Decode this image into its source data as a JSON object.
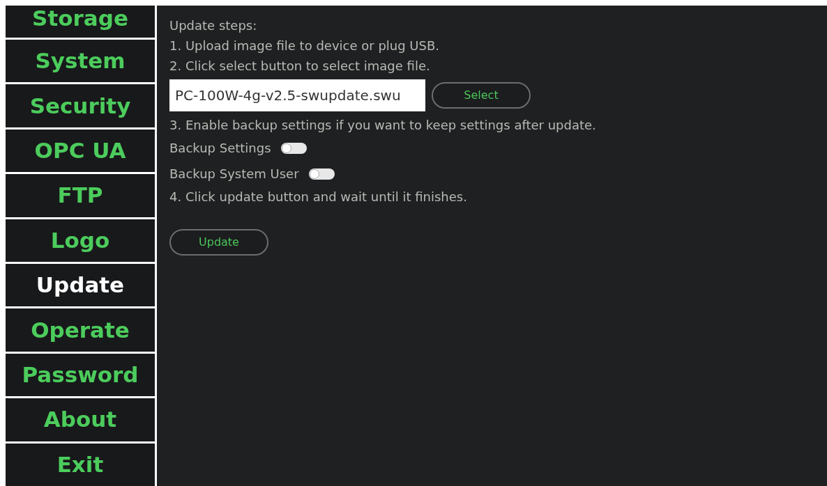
{
  "sidebar": {
    "items": [
      {
        "label": "Storage",
        "selected": false
      },
      {
        "label": "System",
        "selected": false
      },
      {
        "label": "Security",
        "selected": false
      },
      {
        "label": "OPC UA",
        "selected": false
      },
      {
        "label": "FTP",
        "selected": false
      },
      {
        "label": "Logo",
        "selected": false
      },
      {
        "label": "Update",
        "selected": true
      },
      {
        "label": "Operate",
        "selected": false
      },
      {
        "label": "Password",
        "selected": false
      },
      {
        "label": "About",
        "selected": false
      },
      {
        "label": "Exit",
        "selected": false
      }
    ]
  },
  "content": {
    "items": [
      {
        "kind": "text",
        "text": "Update steps:"
      },
      {
        "kind": "text",
        "text": "1. Upload image file to device or plug USB."
      },
      {
        "kind": "text",
        "text": "2. Click select button to select image file."
      },
      {
        "kind": "file",
        "value": "PC-100W-4g-v2.5-swupdate.swu",
        "button": "Select"
      },
      {
        "kind": "text",
        "text": "3. Enable backup settings if you want to keep settings after update."
      },
      {
        "kind": "toggle",
        "label": "Backup Settings",
        "on": false
      },
      {
        "kind": "toggle",
        "label": "Backup System User",
        "on": false
      },
      {
        "kind": "text",
        "text": "4. Click update button and wait until it finishes."
      },
      {
        "kind": "button",
        "label": "Update"
      }
    ]
  }
}
